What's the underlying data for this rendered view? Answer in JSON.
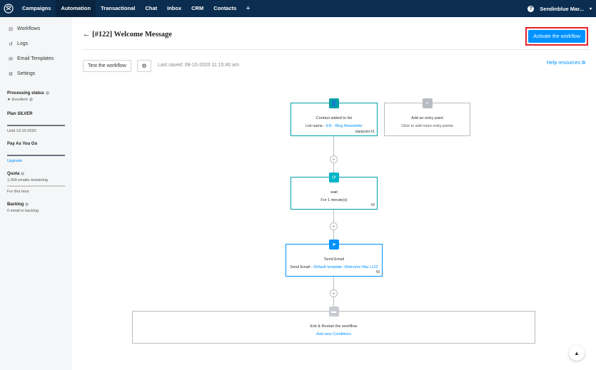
{
  "nav": {
    "items": [
      {
        "label": "Campaigns",
        "active": false
      },
      {
        "label": "Automation",
        "active": true
      },
      {
        "label": "Transactional",
        "active": false
      },
      {
        "label": "Chat",
        "active": false
      },
      {
        "label": "Inbox",
        "active": false
      },
      {
        "label": "CRM",
        "active": false
      },
      {
        "label": "Contacts",
        "active": false
      }
    ],
    "plus": "+",
    "help": "?",
    "account": "Sendinblue Mar...",
    "caret": "▾"
  },
  "sidebar": {
    "items": [
      {
        "label": "Workflows",
        "icon": "⊟"
      },
      {
        "label": "Logs",
        "icon": "↺"
      },
      {
        "label": "Email Templates",
        "icon": "✉"
      },
      {
        "label": "Settings",
        "icon": "⚙"
      }
    ],
    "processing": {
      "title": "Processing status",
      "value": "Excellent",
      "star": "★"
    },
    "plan": {
      "title": "Plan SILVER",
      "until": "Until 13-10-2020"
    },
    "payg": {
      "title": "Pay As You Go",
      "link": "Upgrade"
    },
    "quota": {
      "title": "Quota",
      "value": "1,000 emails remaining",
      "note": "For this hour"
    },
    "backlog": {
      "title": "Backlog",
      "value": "0 email in backlog"
    }
  },
  "header": {
    "title": "[#122] Welcome Message",
    "back": "←",
    "activate": "Activate the workflow",
    "test": "Test the workflow",
    "gear": "⚙",
    "last_saved": "Last saved: 08-10-2020 11:15:40 am",
    "help_resources": "Help resources",
    "external": "⧉"
  },
  "workflow": {
    "start": {
      "title": "Contact added to list",
      "line_prefix": "List name - ",
      "line_link": "EN - Blog Newsletter",
      "num": "startpoint #1",
      "icon": "👤"
    },
    "entry": {
      "title": "Add an entry point",
      "sub": "Click to add more entry points",
      "icon": "+"
    },
    "wait": {
      "title": "wait",
      "sub": "For 1 minute(s)",
      "num": "#2",
      "icon": "⟳"
    },
    "send": {
      "title": "Send Email",
      "line_prefix": "Send Email - ",
      "line_link": "Default template -Welcome Mai L122",
      "num": "#3",
      "icon": "➤"
    },
    "exit": {
      "title": "Exit & Restart the workflow",
      "link": "Add new Conditions",
      "icon": "▬"
    },
    "plus": "+",
    "colors": {
      "teal": "#00a0a8",
      "grey": "#b8bcc2",
      "blue": "#0092ff"
    }
  },
  "float_icon": "▲"
}
